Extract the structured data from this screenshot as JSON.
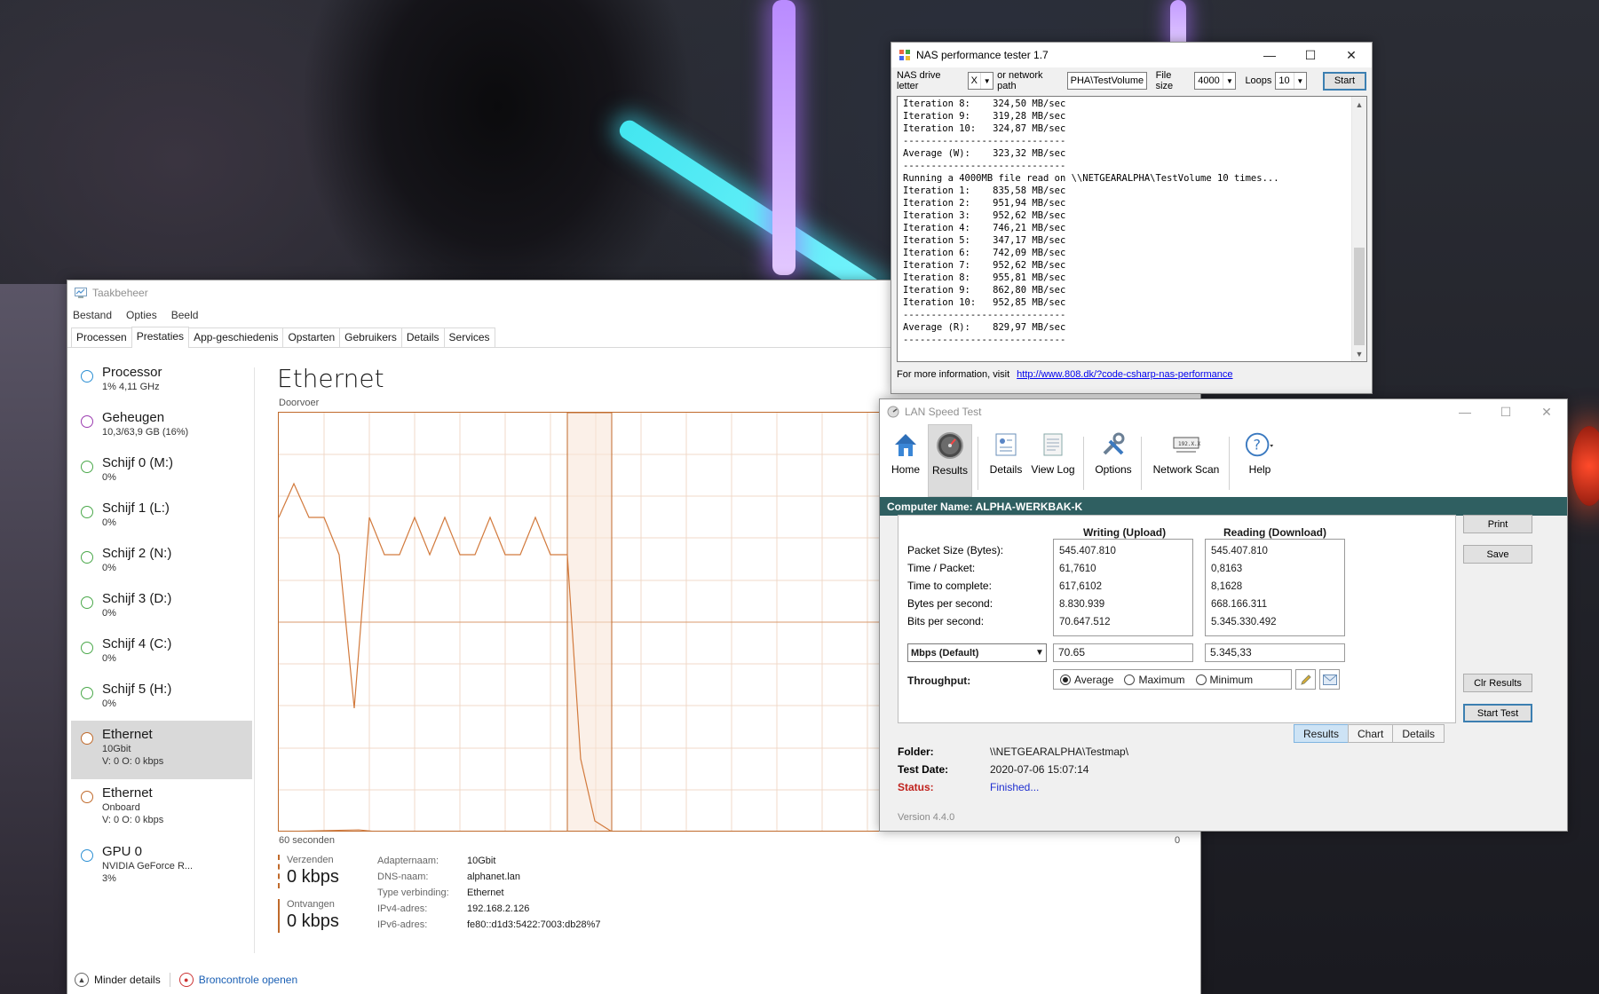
{
  "task_manager": {
    "title": "Taakbeheer",
    "menu": [
      "Bestand",
      "Opties",
      "Beeld"
    ],
    "tabs": [
      "Processen",
      "Prestaties",
      "App-geschiedenis",
      "Opstarten",
      "Gebruikers",
      "Details",
      "Services"
    ],
    "active_tab": "Prestaties",
    "resources": [
      {
        "name": "Processor",
        "sub1": "1% 4,11 GHz",
        "sub2": "",
        "color": "#2b8fd3"
      },
      {
        "name": "Geheugen",
        "sub1": "10,3/63,9 GB (16%)",
        "sub2": "",
        "color": "#9b3bb0"
      },
      {
        "name": "Schijf 0 (M:)",
        "sub1": "0%",
        "sub2": "",
        "color": "#4aa84a"
      },
      {
        "name": "Schijf 1 (L:)",
        "sub1": "0%",
        "sub2": "",
        "color": "#4aa84a"
      },
      {
        "name": "Schijf 2 (N:)",
        "sub1": "0%",
        "sub2": "",
        "color": "#4aa84a"
      },
      {
        "name": "Schijf 3 (D:)",
        "sub1": "0%",
        "sub2": "",
        "color": "#4aa84a"
      },
      {
        "name": "Schijf 4 (C:)",
        "sub1": "0%",
        "sub2": "",
        "color": "#4aa84a"
      },
      {
        "name": "Schijf 5 (H:)",
        "sub1": "0%",
        "sub2": "",
        "color": "#4aa84a"
      },
      {
        "name": "Ethernet",
        "sub1": "10Gbit",
        "sub2": "V: 0 O: 0 kbps",
        "color": "#c06a2b"
      },
      {
        "name": "Ethernet",
        "sub1": "Onboard",
        "sub2": "V: 0 O: 0 kbps",
        "color": "#c06a2b"
      },
      {
        "name": "GPU 0",
        "sub1": "NVIDIA GeForce R...",
        "sub2": "3%",
        "color": "#2b8fd3"
      }
    ],
    "main_title": "Ethernet",
    "graph_label": "Doorvoer",
    "axis_left": "60 seconden",
    "axis_right": "0",
    "send_label": "Verzenden",
    "send_value": "0 kbps",
    "recv_label": "Ontvangen",
    "recv_value": "0 kbps",
    "info": [
      {
        "k": "Adapternaam:",
        "v": "10Gbit"
      },
      {
        "k": "DNS-naam:",
        "v": "alphanet.lan"
      },
      {
        "k": "Type verbinding:",
        "v": "Ethernet"
      },
      {
        "k": "IPv4-adres:",
        "v": "192.168.2.126"
      },
      {
        "k": "IPv6-adres:",
        "v": "fe80::d1d3:5422:7003:db28%7"
      }
    ],
    "footer_less": "Minder details",
    "footer_monitor": "Broncontrole openen"
  },
  "nas": {
    "title": "NAS performance tester 1.7",
    "drive_label": "NAS drive letter",
    "drive_value": "X",
    "path_label": "or network path",
    "path_value": "PHA\\TestVolume",
    "filesize_label": "File size",
    "filesize_value": "4000",
    "loops_label": "Loops",
    "loops_value": "10",
    "start_label": "Start",
    "log": [
      "Iteration 8:    324,50 MB/sec",
      "Iteration 9:    319,28 MB/sec",
      "Iteration 10:   324,87 MB/sec",
      "-----------------------------",
      "Average (W):    323,32 MB/sec",
      "-----------------------------",
      "Running a 4000MB file read on \\\\NETGEARALPHA\\TestVolume 10 times...",
      "Iteration 1:    835,58 MB/sec",
      "Iteration 2:    951,94 MB/sec",
      "Iteration 3:    952,62 MB/sec",
      "Iteration 4:    746,21 MB/sec",
      "Iteration 5:    347,17 MB/sec",
      "Iteration 6:    742,09 MB/sec",
      "Iteration 7:    952,62 MB/sec",
      "Iteration 8:    955,81 MB/sec",
      "Iteration 9:    862,80 MB/sec",
      "Iteration 10:   952,85 MB/sec",
      "-----------------------------",
      "Average (R):    829,97 MB/sec",
      "-----------------------------"
    ],
    "more_info": "For more information, visit",
    "link": "http://www.808.dk/?code-csharp-nas-performance"
  },
  "lst": {
    "title": "LAN Speed Test",
    "ribbon": [
      "Home",
      "Results",
      "Details",
      "View Log",
      "Options",
      "Network Scan",
      "Help"
    ],
    "computer_name": "Computer Name: ALPHA-WERKBAK-K",
    "col_write": "Writing (Upload)",
    "col_read": "Reading (Download)",
    "row_labels": [
      "Packet Size (Bytes):",
      "Time / Packet:",
      "Time to complete:",
      "Bytes per second:",
      "Bits per second:"
    ],
    "write_values": [
      "545.407.810",
      "61,7610",
      "617,6102",
      "8.830.939",
      "70.647.512"
    ],
    "read_values": [
      "545.407.810",
      "0,8163",
      "8,1628",
      "668.166.311",
      "5.345.330.492"
    ],
    "unit": "Mbps (Default)",
    "write_mbps": "70.65",
    "read_mbps": "5.345,33",
    "throughput_label": "Throughput:",
    "radio": [
      "Average",
      "Maximum",
      "Minimum"
    ],
    "buttons": {
      "print": "Print",
      "save": "Save",
      "clr": "Clr Results",
      "start": "Start Test"
    },
    "view_tabs": [
      "Results",
      "Chart",
      "Details"
    ],
    "folder_label": "Folder:",
    "folder_value": "\\\\NETGEARALPHA\\Testmap\\",
    "date_label": "Test Date:",
    "date_value": "2020-07-06 15:07:14",
    "status_label": "Status:",
    "status_value": "Finished...",
    "version": "Version 4.4.0"
  }
}
